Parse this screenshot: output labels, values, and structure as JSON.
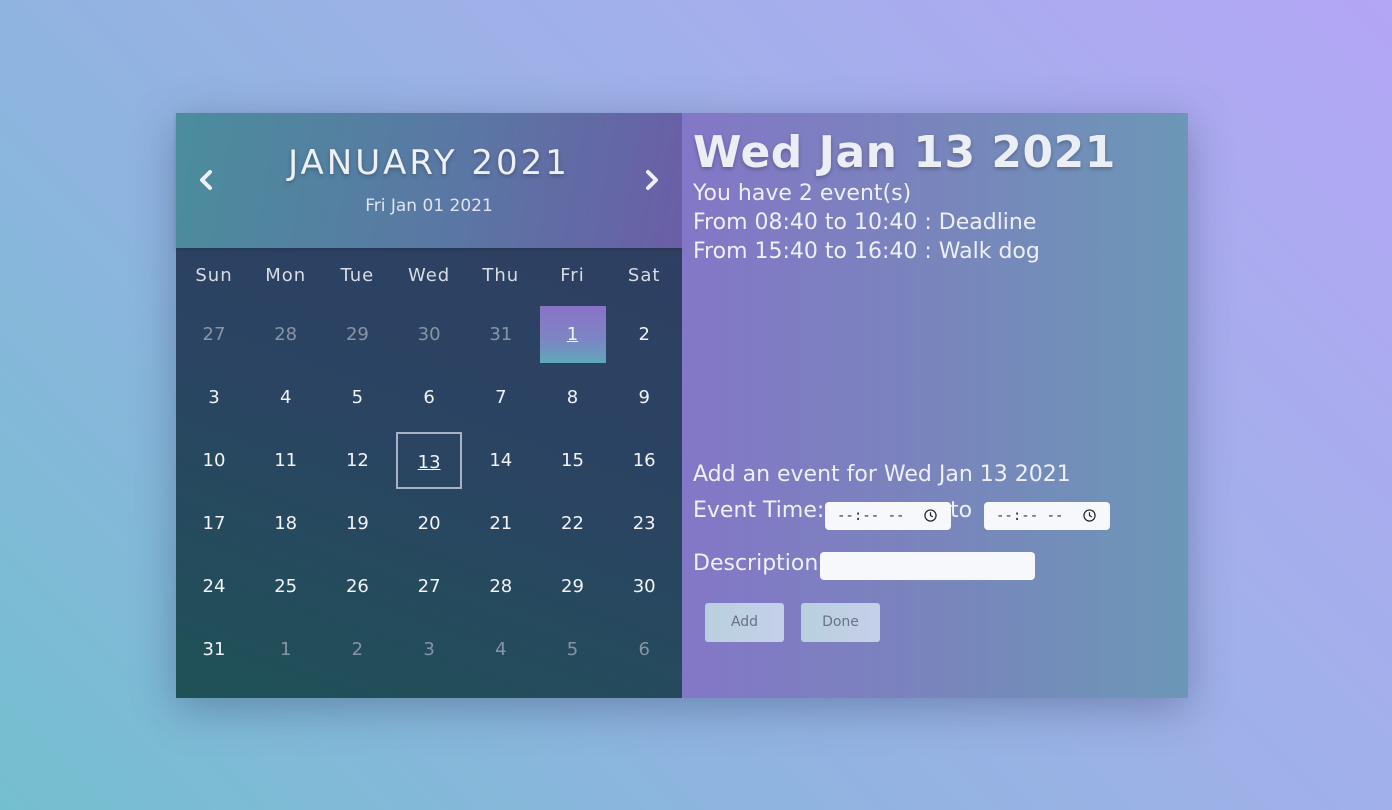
{
  "calendar": {
    "month_title": "JANUARY 2021",
    "current_date": "Fri Jan 01 2021",
    "prev_icon": "chevron-left-icon",
    "next_icon": "chevron-right-icon",
    "weekdays": [
      "Sun",
      "Mon",
      "Tue",
      "Wed",
      "Thu",
      "Fri",
      "Sat"
    ],
    "weeks": [
      [
        {
          "d": "27",
          "m": true
        },
        {
          "d": "28",
          "m": true
        },
        {
          "d": "29",
          "m": true
        },
        {
          "d": "30",
          "m": true
        },
        {
          "d": "31",
          "m": true
        },
        {
          "d": "1",
          "today": true
        },
        {
          "d": "2"
        }
      ],
      [
        {
          "d": "3"
        },
        {
          "d": "4"
        },
        {
          "d": "5"
        },
        {
          "d": "6"
        },
        {
          "d": "7"
        },
        {
          "d": "8"
        },
        {
          "d": "9"
        }
      ],
      [
        {
          "d": "10"
        },
        {
          "d": "11"
        },
        {
          "d": "12"
        },
        {
          "d": "13",
          "selected": true
        },
        {
          "d": "14"
        },
        {
          "d": "15"
        },
        {
          "d": "16"
        }
      ],
      [
        {
          "d": "17"
        },
        {
          "d": "18"
        },
        {
          "d": "19"
        },
        {
          "d": "20"
        },
        {
          "d": "21"
        },
        {
          "d": "22"
        },
        {
          "d": "23"
        }
      ],
      [
        {
          "d": "24"
        },
        {
          "d": "25"
        },
        {
          "d": "26"
        },
        {
          "d": "27"
        },
        {
          "d": "28"
        },
        {
          "d": "29"
        },
        {
          "d": "30"
        }
      ],
      [
        {
          "d": "31"
        },
        {
          "d": "1",
          "m": true
        },
        {
          "d": "2",
          "m": true
        },
        {
          "d": "3",
          "m": true
        },
        {
          "d": "4",
          "m": true
        },
        {
          "d": "5",
          "m": true
        },
        {
          "d": "6",
          "m": true
        }
      ]
    ]
  },
  "panel": {
    "title": "Wed Jan 13 2021",
    "event_count": "You have 2 event(s)",
    "events": [
      "From 08:40 to 10:40 : Deadline",
      "From 15:40 to 16:40 : Walk dog"
    ],
    "add_title": "Add an event for Wed Jan 13 2021",
    "event_time_label": "Event Time:",
    "time_start_value": "--:-- --",
    "to_label": "to",
    "time_end_value": "--:-- --",
    "clock_icon": "clock-icon",
    "description_label": "Description:",
    "description_value": "",
    "add_button": "Add",
    "done_button": "Done"
  }
}
